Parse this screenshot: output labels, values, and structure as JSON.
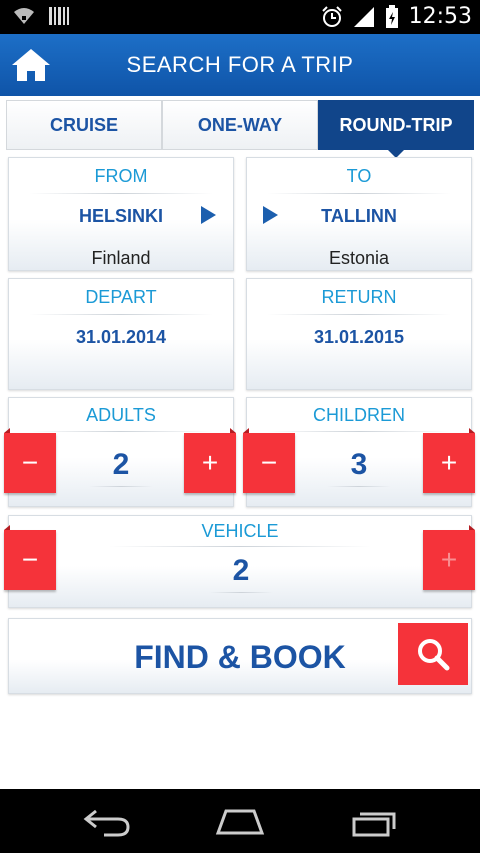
{
  "status_bar": {
    "time": "12:53",
    "icons": [
      "wifi-icon",
      "barcode-icon",
      "alarm-icon",
      "signal-icon",
      "battery-icon"
    ]
  },
  "header": {
    "title": "SEARCH FOR A TRIP",
    "home_icon": "home-icon"
  },
  "tabs": [
    {
      "label": "CRUISE",
      "active": false
    },
    {
      "label": "ONE-WAY",
      "active": false
    },
    {
      "label": "ROUND-TRIP",
      "active": true
    }
  ],
  "route": {
    "from": {
      "label": "FROM",
      "city": "HELSINKI",
      "country": "Finland"
    },
    "to": {
      "label": "TO",
      "city": "TALLINN",
      "country": "Estonia"
    }
  },
  "dates": {
    "depart": {
      "label": "DEPART",
      "value": "31.01.2014"
    },
    "return": {
      "label": "RETURN",
      "value": "31.01.2015"
    }
  },
  "passengers": {
    "adults": {
      "label": "ADULTS",
      "value": "2"
    },
    "children": {
      "label": "CHILDREN",
      "value": "3"
    }
  },
  "vehicle": {
    "label": "VEHICLE",
    "value": "2"
  },
  "controls": {
    "minus": "−",
    "plus": "+"
  },
  "find": {
    "label": "FIND & BOOK",
    "icon": "search-icon"
  },
  "nav": {
    "icons": [
      "back-icon",
      "home-nav-icon",
      "recent-apps-icon"
    ]
  },
  "colors": {
    "brand_blue": "#1c54a4",
    "accent_red": "#f5333a",
    "label_blue": "#1b9ad6",
    "header_blue": "#0f54a8"
  }
}
